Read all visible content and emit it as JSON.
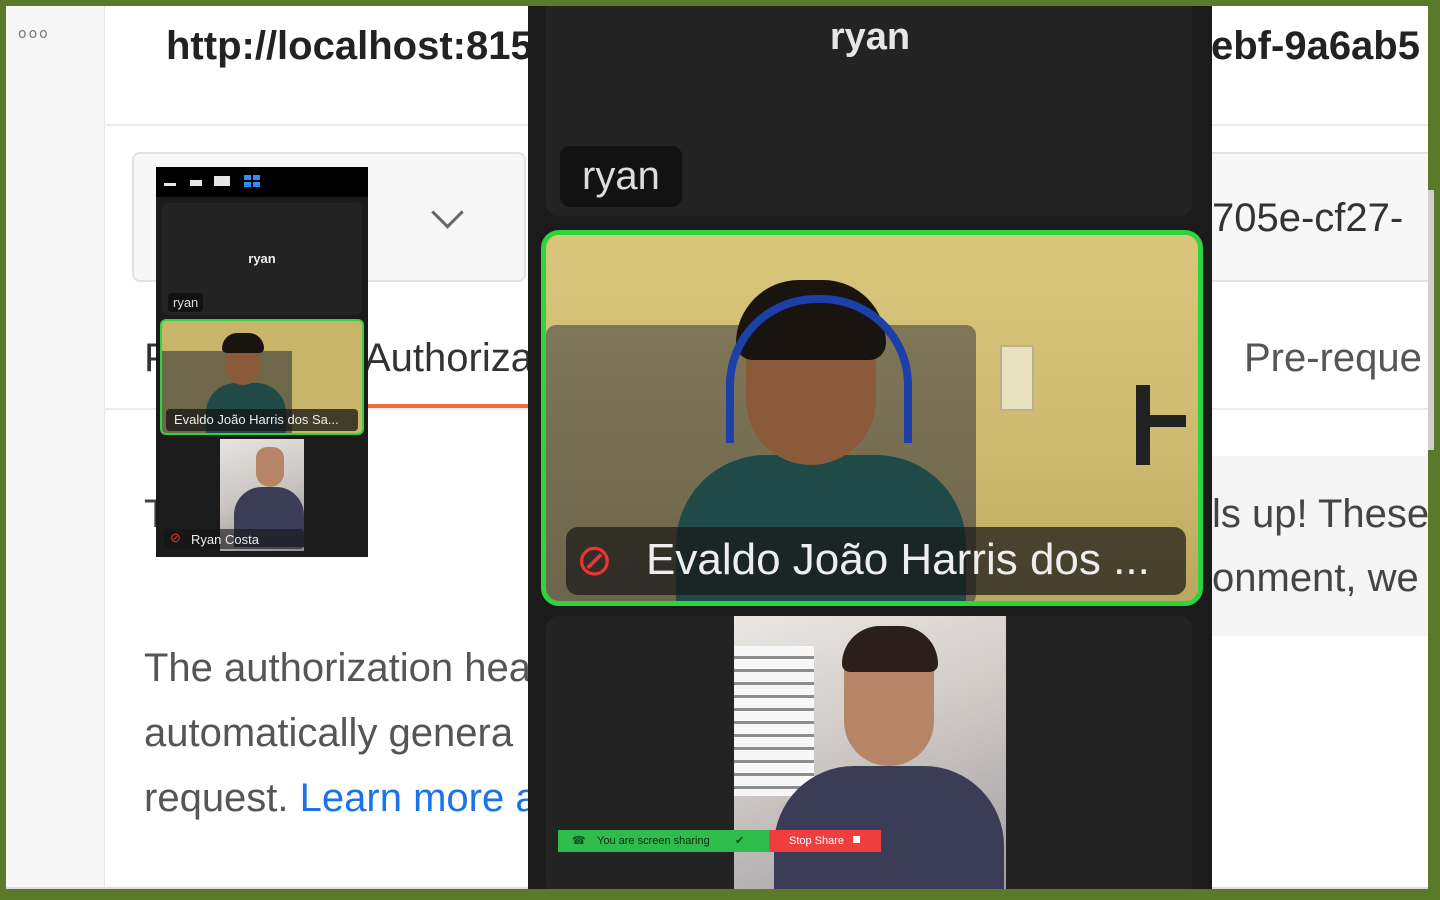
{
  "postman": {
    "menu_dots": "ooo",
    "url_left": "http://localhost:815",
    "url_right": "ebf-9a6ab5",
    "url_box_right": "705e-cf27-",
    "tab_p": "P",
    "tab_auth": "Authoriza",
    "tab_pre": "Pre-reque",
    "info_line1": "ls up! These",
    "info_line2": "onment, we",
    "body_T": "T",
    "para_line1": "The authorization hea",
    "para_line2": "automatically genera",
    "para_line3_prefix": "request.",
    "para_link": "Learn more a"
  },
  "zoom_main": {
    "top_name": "ryan",
    "top_chip": "ryan",
    "active_speaker": "Evaldo João Harris dos ...",
    "active_muted": true
  },
  "share_bar": {
    "text": "You are screen sharing",
    "stop_label": "Stop Share"
  },
  "zoom_mini": {
    "top_name": "ryan",
    "top_chip": "ryan",
    "active_speaker": "Evaldo João Harris dos Sa...",
    "bottom_name": "Ryan Costa",
    "bottom_muted": true
  },
  "colors": {
    "accent_green": "#2ed43f",
    "share_green": "#2ebd4a",
    "stop_red": "#ef3e3e",
    "postman_orange": "#f26b3a",
    "link_blue": "#1a73e8",
    "outer_frame": "#5a7a2a"
  },
  "icons": {
    "muted": "mic-off-icon",
    "phone": "phone-icon",
    "shield": "shield-icon",
    "chevron": "chevron-down-icon",
    "grid": "grid-view-icon"
  }
}
